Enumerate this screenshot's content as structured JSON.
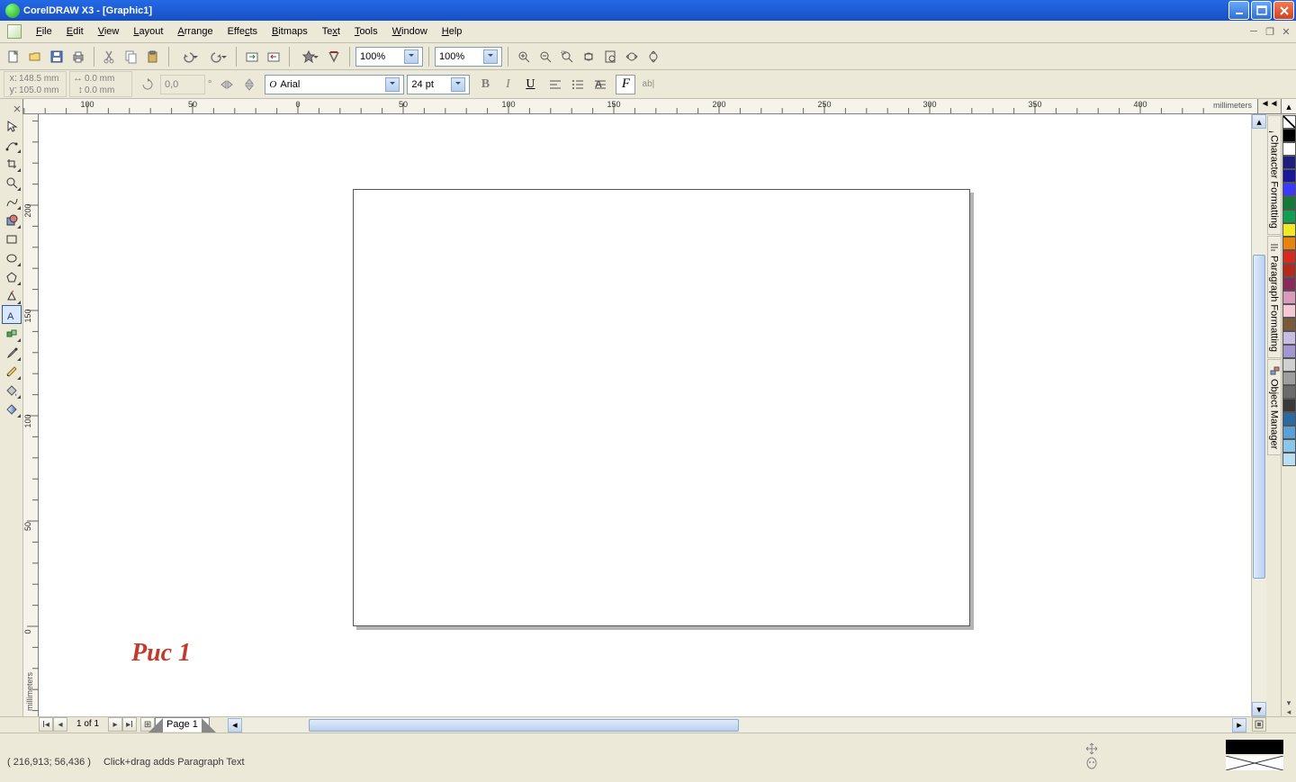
{
  "titlebar": {
    "text": "CorelDRAW X3 - [Graphic1]"
  },
  "menu": [
    "File",
    "Edit",
    "View",
    "Layout",
    "Arrange",
    "Effects",
    "Bitmaps",
    "Text",
    "Tools",
    "Window",
    "Help"
  ],
  "zoom1": "100%",
  "zoom2": "100%",
  "props": {
    "xlabel": "x:",
    "x": "148.5 mm",
    "ylabel": "y:",
    "y": "105.0 mm",
    "w": "0.0 mm",
    "h": "0.0 mm",
    "rot": "0,0",
    "font": "Arial",
    "size": "24 pt"
  },
  "ruler_unit": "millimeters",
  "ruler_h": [
    -100,
    -50,
    0,
    50,
    100,
    150,
    200,
    250,
    300,
    350,
    400
  ],
  "ruler_v": [
    0,
    50,
    100,
    150,
    200
  ],
  "docker_tabs": [
    "Character Formatting",
    "Paragraph Formatting",
    "Object Manager"
  ],
  "palette": [
    "#000000",
    "#FFFFFF",
    "#1e1e7d",
    "#18189c",
    "#3a3aff",
    "#147a3a",
    "#0f9e52",
    "#f2e926",
    "#e88312",
    "#d62a1e",
    "#b22a1e",
    "#8a2a5a",
    "#d89abd",
    "#f5c8d6",
    "#7a5a3a",
    "#c8bde0",
    "#a396d0",
    "#cfcfcf",
    "#9e9e9e",
    "#6a6a6a",
    "#3a3a3a",
    "#2a6aa0",
    "#5aa0d6",
    "#8ac6e8",
    "#b8e0f2"
  ],
  "page_nav": {
    "count": "1 of 1",
    "tab": "Page 1"
  },
  "status": {
    "coords": "( 216,913; 56,436 )",
    "hint": "Click+drag adds Paragraph Text"
  },
  "art_label": "Рис 1"
}
